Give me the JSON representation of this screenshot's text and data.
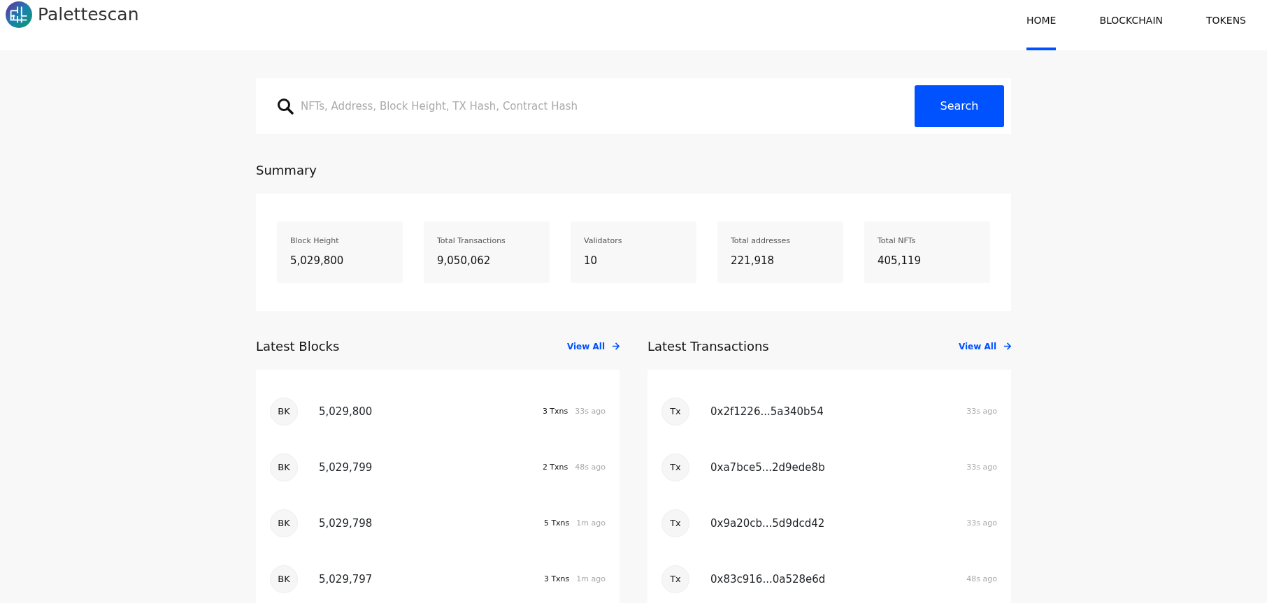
{
  "brand": {
    "name": "Palettescan"
  },
  "nav": [
    {
      "label": "HOME",
      "selected": true
    },
    {
      "label": "BLOCKCHAIN",
      "selected": false
    },
    {
      "label": "TOKENS",
      "selected": false
    }
  ],
  "search": {
    "placeholder": "NFTs, Address, Block Height, TX Hash, Contract Hash",
    "button": "Search"
  },
  "summary": {
    "title": "Summary",
    "stats": [
      {
        "label": "Block Height",
        "value": "5,029,800"
      },
      {
        "label": "Total Transactions",
        "value": "9,050,062"
      },
      {
        "label": "Validators",
        "value": "10"
      },
      {
        "label": "Total addresses",
        "value": "221,918"
      },
      {
        "label": "Total NFTs",
        "value": "405,119"
      }
    ]
  },
  "panels": [
    {
      "title": "Latest Blocks",
      "link": "View All",
      "rows": [
        {
          "badge": "BK",
          "id": "5,029,800",
          "txns": "3 Txns",
          "age": "33s ago"
        },
        {
          "badge": "BK",
          "id": "5,029,799",
          "txns": "2 Txns",
          "age": "48s ago"
        },
        {
          "badge": "BK",
          "id": "5,029,798",
          "txns": "5 Txns",
          "age": "1m ago"
        },
        {
          "badge": "BK",
          "id": "5,029,797",
          "txns": "3 Txns",
          "age": "1m ago"
        }
      ]
    },
    {
      "title": "Latest Transactions",
      "link": "View All",
      "rows": [
        {
          "badge": "Tx",
          "id": "0x2f1226...5a340b54",
          "age": "33s ago"
        },
        {
          "badge": "Tx",
          "id": "0xa7bce5...2d9ede8b",
          "age": "33s ago"
        },
        {
          "badge": "Tx",
          "id": "0x9a20cb...5d9dcd42",
          "age": "33s ago"
        },
        {
          "badge": "Tx",
          "id": "0x83c916...0a528e6d",
          "age": "48s ago"
        }
      ]
    }
  ]
}
